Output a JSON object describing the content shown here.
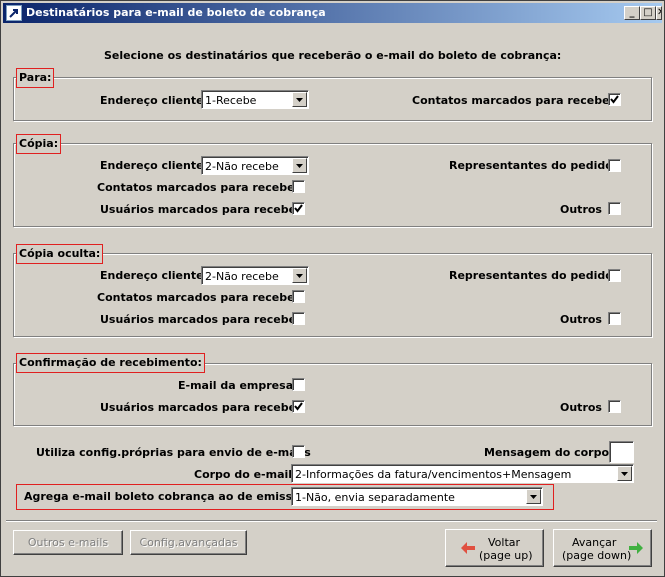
{
  "window": {
    "title": "Destinatários para e-mail de boleto de cobrança",
    "min_glyph": "_",
    "max_glyph": "□",
    "close_glyph": "✕"
  },
  "instruction": "Selecione os destinatários que receberão o e-mail do boleto de cobrança:",
  "para": {
    "legend": "Para:",
    "endereco_label": "Endereço cliente",
    "endereco_value": "1-Recebe",
    "contatos_label": "Contatos marcados para receber",
    "contatos_checked": true
  },
  "copia": {
    "legend": "Cópia:",
    "endereco_label": "Endereço cliente",
    "endereco_value": "2-Não recebe",
    "representantes_label": "Representantes do pedido",
    "representantes_checked": false,
    "contatos_label": "Contatos marcados para receber",
    "contatos_checked": false,
    "usuarios_label": "Usuários marcados para receber",
    "usuarios_checked": true,
    "outros_label": "Outros",
    "outros_checked": false
  },
  "copia_oculta": {
    "legend": "Cópia oculta:",
    "endereco_label": "Endereço cliente",
    "endereco_value": "2-Não recebe",
    "representantes_label": "Representantes do pedido",
    "representantes_checked": false,
    "contatos_label": "Contatos marcados para receber",
    "contatos_checked": false,
    "usuarios_label": "Usuários marcados para receber",
    "usuarios_checked": false,
    "outros_label": "Outros",
    "outros_checked": false
  },
  "confirmacao": {
    "legend": "Confirmação de recebimento:",
    "email_empresa_label": "E-mail da empresa",
    "email_empresa_checked": false,
    "usuarios_label": "Usuários marcados para receber",
    "usuarios_checked": true,
    "outros_label": "Outros",
    "outros_checked": false
  },
  "config": {
    "utiliza_label": "Utiliza config.próprias para envio de e-mails",
    "utiliza_checked": false,
    "mensagem_label": "Mensagem do corpo",
    "mensagem_value": "",
    "corpo_label": "Corpo do e-mail",
    "corpo_value": "2-Informações da fatura/vencimentos+Mensagem",
    "agrega_label": "Agrega e-mail boleto cobrança ao de emissão",
    "agrega_value": "1-Não, envia separadamente"
  },
  "buttons": {
    "outros_emails": "Outros e-mails",
    "config_avancadas": "Config.avançadas",
    "voltar_line1": "Voltar",
    "voltar_line2": "(page up)",
    "avancar_line1": "Avançar",
    "avancar_line2": "(page down)"
  },
  "colors": {
    "accent_red": "#e02020",
    "voltar_arrow": "#e05040",
    "avancar_arrow": "#40b040"
  }
}
